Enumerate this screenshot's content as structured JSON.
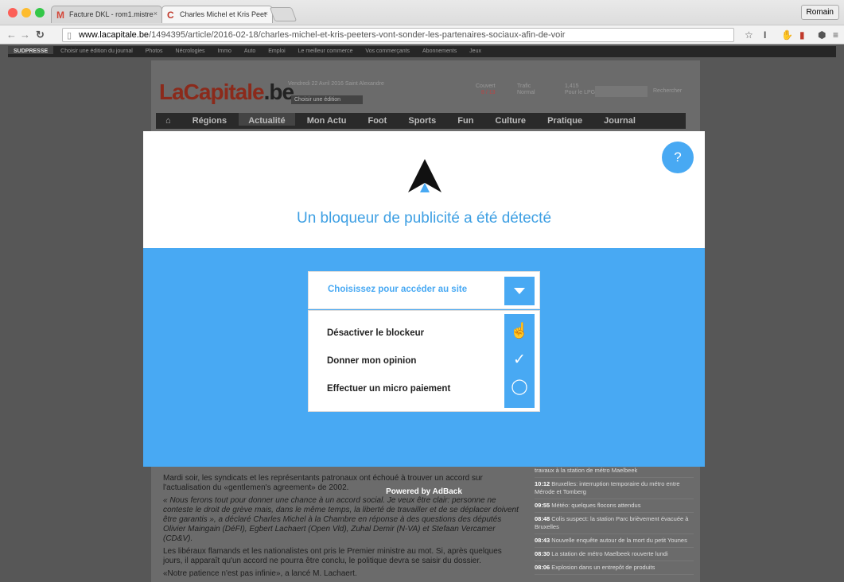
{
  "tabs": [
    {
      "label": "Facture DKL - rom1.mistre",
      "close": "×"
    },
    {
      "label": "Charles Michel et Kris Peet",
      "close": "×"
    }
  ],
  "user": "Romain",
  "address": {
    "domain": "www.lacapitale.be",
    "path": "/1494395/article/2016-02-18/charles-michel-et-kris-peeters-vont-sonder-les-partenaires-sociaux-afin-de-voir"
  },
  "topbar": [
    "SUDPRESSE",
    "Choisir une édition du journal",
    "Photos",
    "Nécrologies",
    "Immo",
    "Auto",
    "Emploi",
    "Le meilleur commerce",
    "Vos commerçants",
    "Abonnements",
    "Jeux"
  ],
  "site": {
    "logo_a": "LaCapitale",
    "logo_b": ".be",
    "date": "Vendredi 22 Avril 2016 Saint Alexandre",
    "edition": "Choisir une édition",
    "weather": "Couvert",
    "weather_temp": "8 / 13",
    "traffic": "Trafic",
    "traffic_state": "Normal",
    "lpg": "1,415",
    "lpg_label": "Pour le LPG",
    "search": "Rechercher",
    "menu": [
      "Régions",
      "Actualité",
      "Mon Actu",
      "Foot",
      "Sports",
      "Fun",
      "Culture",
      "Pratique",
      "Journal"
    ]
  },
  "article": [
    "Mardi soir, les syndicats et les représentants patronaux ont échoué à trouver un accord sur l'actualisation du «gentlemen's agreement» de 2002.",
    "« Nous ferons tout pour donner une chance à un accord social. Je veux être clair: personne ne conteste le droit de grève mais, dans le même temps, la liberté de travailler et de se déplacer doivent être garantis », a déclaré Charles Michel à la Chambre en réponse à des questions des députés Olivier Maingain (DéFI), Egbert Lachaert (Open Vld), Zuhal Demir (N-VA) et Stefaan Vercamer (CD&V).",
    "Les libéraux flamands et les nationalistes ont pris le Premier ministre au mot. Si, après quelques jours, il apparaît qu'un accord ne pourra être conclu, le politique devra se saisir du dossier.",
    "«Notre patience n'est pas infinie», a lancé M. Lachaert."
  ],
  "news": [
    {
      "time": "",
      "text": "travaux à la station de métro Maelbeek"
    },
    {
      "time": "10:12",
      "text": "Bruxelles: interruption temporaire du métro entre Mérode et Tomberg"
    },
    {
      "time": "09:55",
      "text": "Météo: quelques flocons attendus"
    },
    {
      "time": "08:48",
      "text": "Colis suspect: la station Parc brièvement évacuée à Bruxelles"
    },
    {
      "time": "08:43",
      "text": "Nouvelle enquête autour de la mort du petit Younes"
    },
    {
      "time": "08:30",
      "text": "La station de métro Maelbeek rouverte lundi"
    },
    {
      "time": "08:06",
      "text": "Explosion dans un entrepôt de produits"
    }
  ],
  "modal": {
    "help": "?",
    "title": "Un bloqueur de publicité a été détecté",
    "select_label": "Choisissez pour accéder au site",
    "options": [
      {
        "label": "Désactiver le blockeur",
        "icon": "hand-pointer-icon"
      },
      {
        "label": "Donner mon opinion",
        "icon": "checkmark-icon"
      },
      {
        "label": "Effectuer un micro paiement",
        "icon": "coin-icon"
      }
    ],
    "powered": "Powered by AdBack"
  },
  "colors": {
    "accent": "#48a9f3",
    "title": "#3d9fe3"
  }
}
